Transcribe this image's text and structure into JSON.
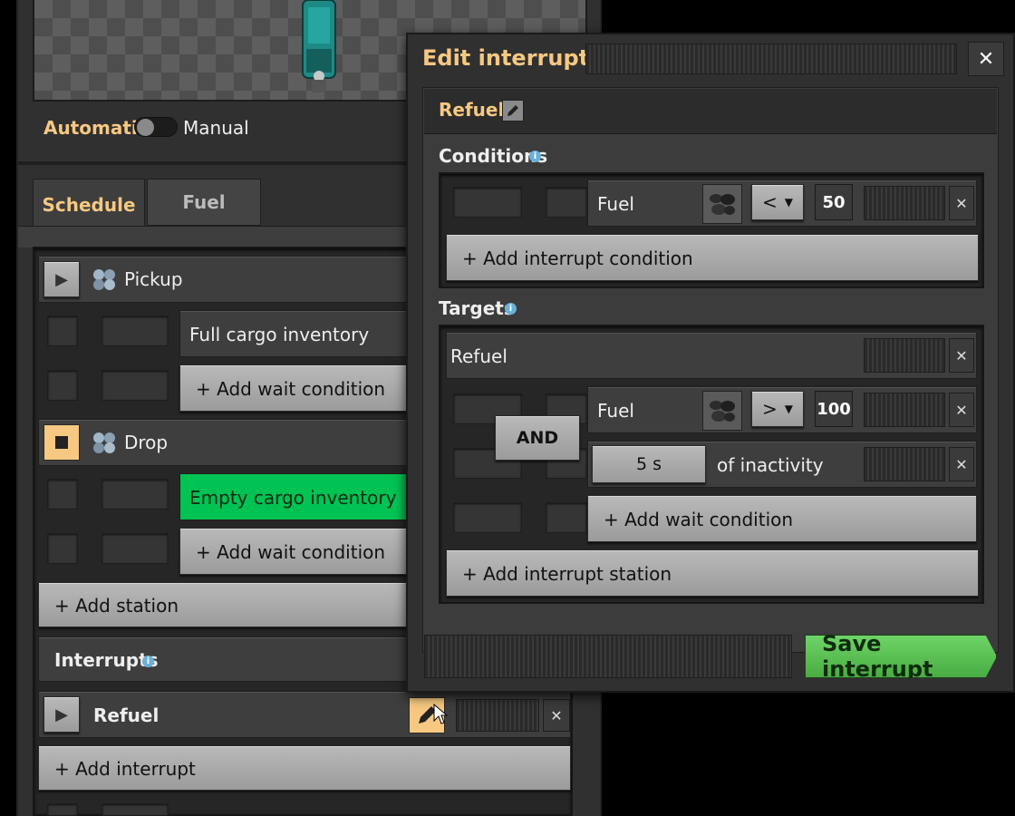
{
  "train": {
    "mode_automatic": "Automatic",
    "mode_manual": "Manual",
    "tabs": [
      {
        "label": "Schedule",
        "active": true
      },
      {
        "label": "Fuel",
        "active": false
      }
    ],
    "stations": [
      {
        "name": "Pickup",
        "conditions": [
          "Full cargo inventory"
        ],
        "add_label": "+ Add wait condition",
        "state": "play"
      },
      {
        "name": "Drop",
        "conditions": [
          "Empty cargo inventory"
        ],
        "add_label": "+ Add wait condition",
        "state": "stop"
      }
    ],
    "add_station": "+ Add station",
    "interrupts_heading": "Interrupts",
    "interrupt_name": "Refuel",
    "add_interrupt": "+ Add interrupt"
  },
  "dialog": {
    "title": "Edit interrupt",
    "name": "Refuel",
    "conditions_heading": "Conditions",
    "condition": {
      "signal": "Fuel",
      "operator": "<",
      "value": "50"
    },
    "add_interrupt_condition": "+ Add interrupt condition",
    "targets_heading": "Targets",
    "target_station": "Refuel",
    "and_label": "AND",
    "target_conditions": [
      {
        "signal": "Fuel",
        "operator": ">",
        "value": "100"
      },
      {
        "duration": "5 s",
        "text": "of inactivity"
      }
    ],
    "add_wait_condition": "+ Add wait condition",
    "add_interrupt_station": "+ Add interrupt station",
    "save_label": "Save interrupt"
  },
  "colors": {
    "accent_orange": "#f6c881",
    "green_active": "#00c354",
    "save_green": "#54c14e"
  },
  "icons": [
    "play-icon",
    "stop-icon",
    "item-icon",
    "edit-icon",
    "close-icon",
    "info-icon",
    "coal-icon",
    "chevron-down-icon"
  ]
}
